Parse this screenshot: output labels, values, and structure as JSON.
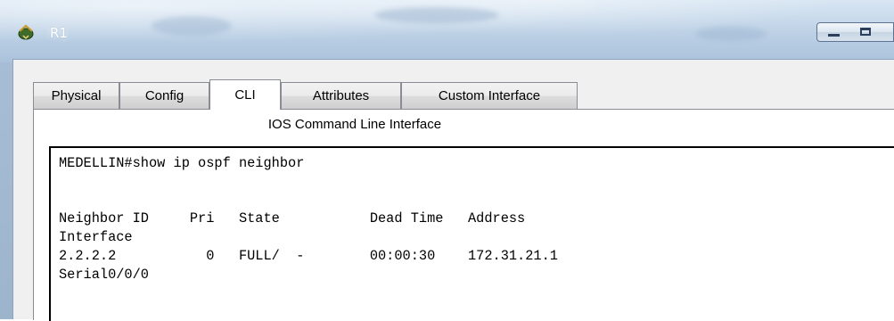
{
  "window": {
    "title": "R1",
    "icon": "router-icon",
    "controls": [
      "minimize-icon",
      "maximize-icon"
    ]
  },
  "tabs": [
    {
      "label": "Physical",
      "active": false
    },
    {
      "label": "Config",
      "active": false
    },
    {
      "label": "CLI",
      "active": true
    },
    {
      "label": "Attributes",
      "active": false
    },
    {
      "label": "Custom Interface",
      "active": false
    }
  ],
  "cli": {
    "heading": "IOS Command Line Interface",
    "lines": [
      "MEDELLIN#show ip ospf neighbor",
      "",
      "",
      "Neighbor ID     Pri   State           Dead Time   Address",
      "Interface",
      "2.2.2.2           0   FULL/  -        00:00:30    172.31.21.1",
      "Serial0/0/0"
    ]
  },
  "colors": {
    "title_glass": "#bcd0e5",
    "client_bg": "#f0f0f0",
    "console_border": "#000000"
  }
}
